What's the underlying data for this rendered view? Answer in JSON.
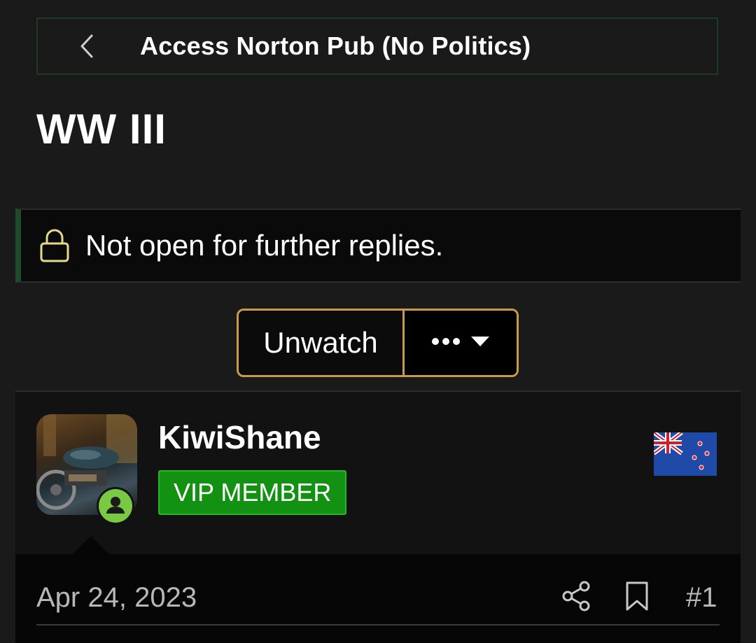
{
  "breadcrumb": {
    "label": "Access Norton Pub (No Politics)",
    "icon": "chevron-left-icon"
  },
  "thread": {
    "title": "WW III"
  },
  "notice": {
    "text": "Not open for further replies.",
    "icon": "lock-icon",
    "icon_color": "#e6d98a"
  },
  "actions": {
    "unwatch_label": "Unwatch",
    "more_icon": "ellipsis-icon",
    "dropdown_icon": "caret-down-icon",
    "accent_color": "#c99a4a"
  },
  "post": {
    "username": "KiwiShane",
    "badge": "VIP MEMBER",
    "badge_color": "#139113",
    "online_icon": "user-online-icon",
    "online_color": "#7ac943",
    "flag": "new-zealand-flag",
    "date": "Apr 24, 2023",
    "number": "#1"
  }
}
